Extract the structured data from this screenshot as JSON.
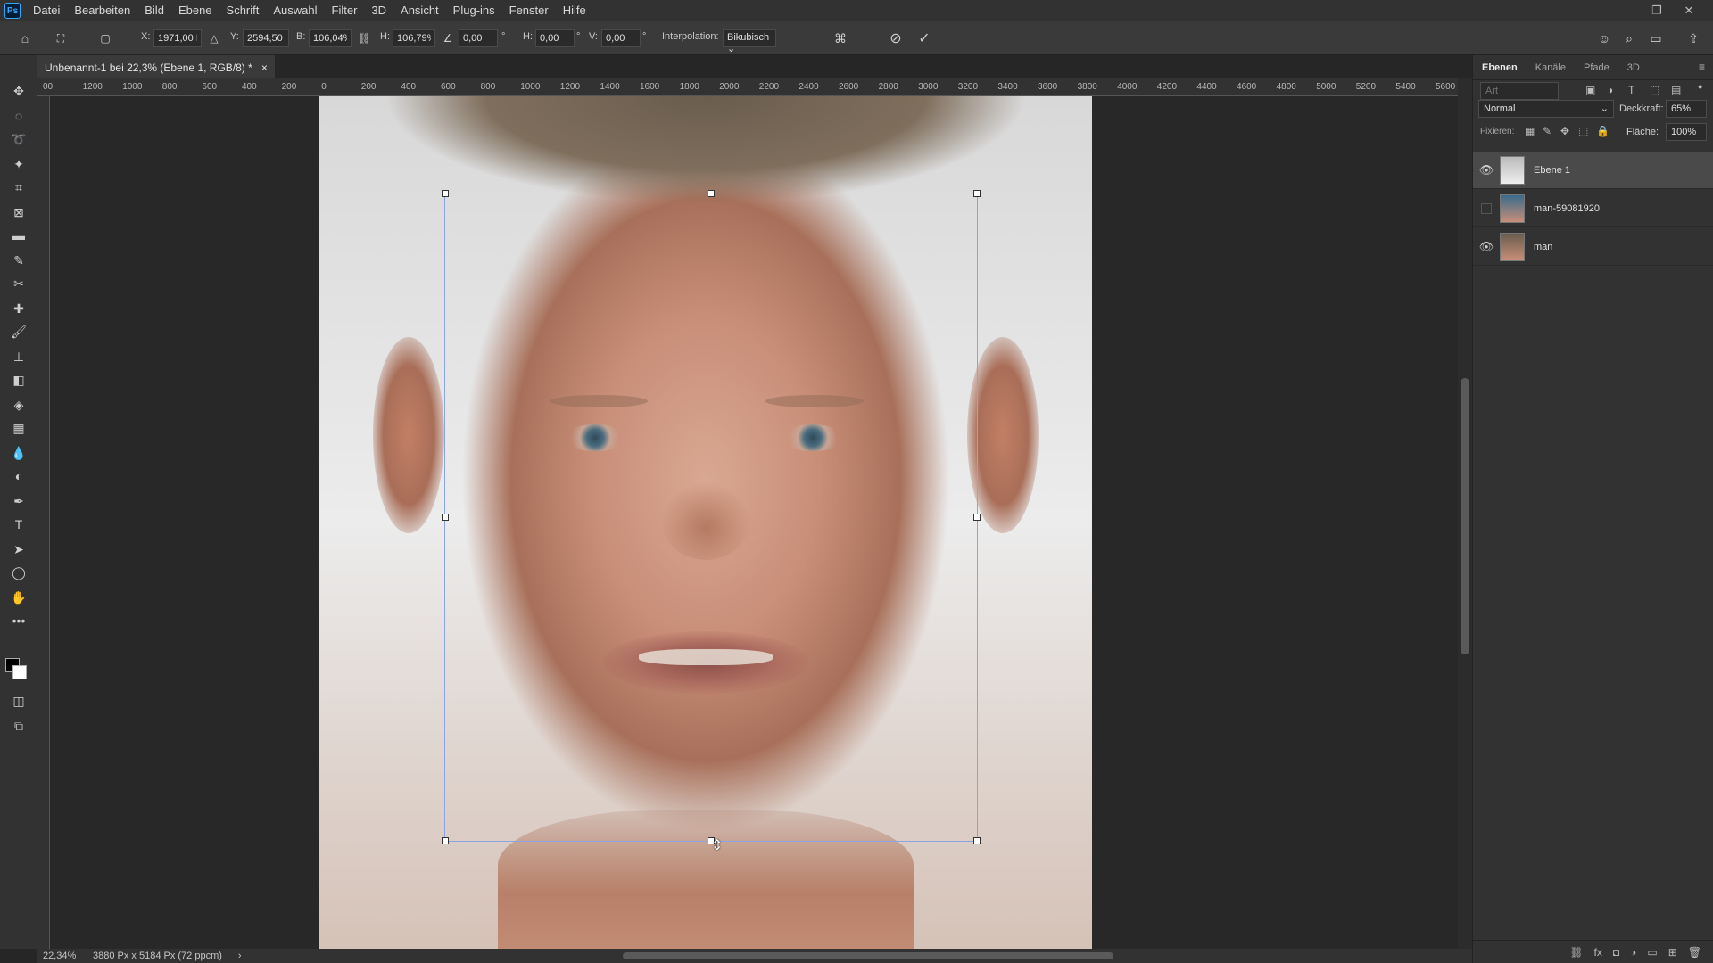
{
  "app": {
    "logo": "Ps"
  },
  "menu": [
    "Datei",
    "Bearbeiten",
    "Bild",
    "Ebene",
    "Schrift",
    "Auswahl",
    "Filter",
    "3D",
    "Ansicht",
    "Plug-ins",
    "Fenster",
    "Hilfe"
  ],
  "options": {
    "x_label": "X:",
    "x_value": "1971,00 Px",
    "y_label": "Y:",
    "y_value": "2594,50 Px",
    "w_label": "B:",
    "w_value": "106,04%",
    "h_label": "H:",
    "h_value": "106,79%",
    "angle_value": "0,00",
    "deg1": "°",
    "skew_h_label": "H:",
    "skew_h_value": "0,00",
    "deg2": "°",
    "skew_v_label": "V:",
    "skew_v_value": "0,00",
    "deg3": "°",
    "interp_label": "Interpolation:",
    "interp_value": "Bikubisch"
  },
  "document": {
    "tab_title": "Unbenannt-1 bei 22,3% (Ebene 1, RGB/8) *",
    "close": "×"
  },
  "ruler": {
    "top_labels": [
      "00",
      "1200",
      "1000",
      "800",
      "600",
      "400",
      "200",
      "0",
      "200",
      "400",
      "600",
      "800",
      "1000",
      "1200",
      "1400",
      "1600",
      "1800",
      "2000",
      "2200",
      "2400",
      "2600",
      "2800",
      "3000",
      "3200",
      "3400",
      "3600",
      "3800",
      "4000",
      "4200",
      "4400",
      "4600",
      "4800",
      "5000",
      "5200",
      "5400",
      "5600"
    ]
  },
  "status": {
    "zoom": "22,34%",
    "doc_info": "3880 Px x 5184 Px (72 ppcm)",
    "arrow": "›"
  },
  "panel": {
    "tabs": [
      "Ebenen",
      "Kanäle",
      "Pfade",
      "3D"
    ],
    "search_placeholder": "Art",
    "blend_mode": "Normal",
    "opacity_label": "Deckkraft:",
    "opacity_value": "65%",
    "lock_label": "Fixieren:",
    "fill_label": "Fläche:",
    "fill_value": "100%",
    "layers": [
      {
        "name": "Ebene 1",
        "visible": true,
        "selected": true
      },
      {
        "name": "man-59081920",
        "visible": false,
        "selected": false
      },
      {
        "name": "man",
        "visible": true,
        "selected": false
      }
    ]
  }
}
